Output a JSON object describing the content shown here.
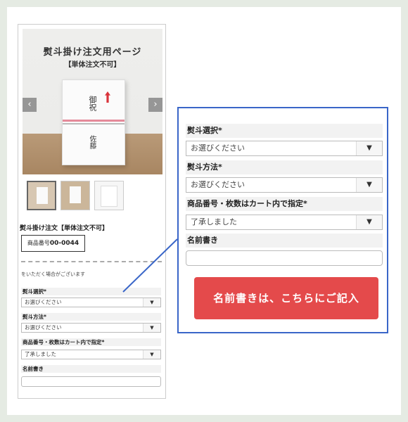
{
  "product": {
    "hero_title": "熨斗掛け注文用ページ",
    "hero_subtitle": "【単体注文不可】",
    "noshi_top": "御祝",
    "noshi_name": "佐藤",
    "title": "熨斗掛け注文【単体注文不可】",
    "sku_label": "商品番号",
    "sku_value": "00-0044",
    "note": "をいただく場合がございます"
  },
  "carousel": {
    "prev_icon": "chevron-left-icon",
    "next_icon": "chevron-right-icon",
    "prev_glyph": "‹",
    "next_glyph": "›"
  },
  "form": {
    "noshi_select_label": "熨斗選択*",
    "noshi_select_value": "お選びください",
    "noshi_method_label": "熨斗方法*",
    "noshi_method_value": "お選びください",
    "spec_label": "商品番号・枚数はカート内で指定*",
    "spec_value": "了承しました",
    "name_label": "名前書き",
    "caret": "▼"
  },
  "callout": {
    "cta_label": "名前書きは、こちらにご記入"
  },
  "colors": {
    "callout_border": "#3a66c8",
    "cta_bg": "#e44a4b",
    "page_bg": "#e5ebe3"
  }
}
